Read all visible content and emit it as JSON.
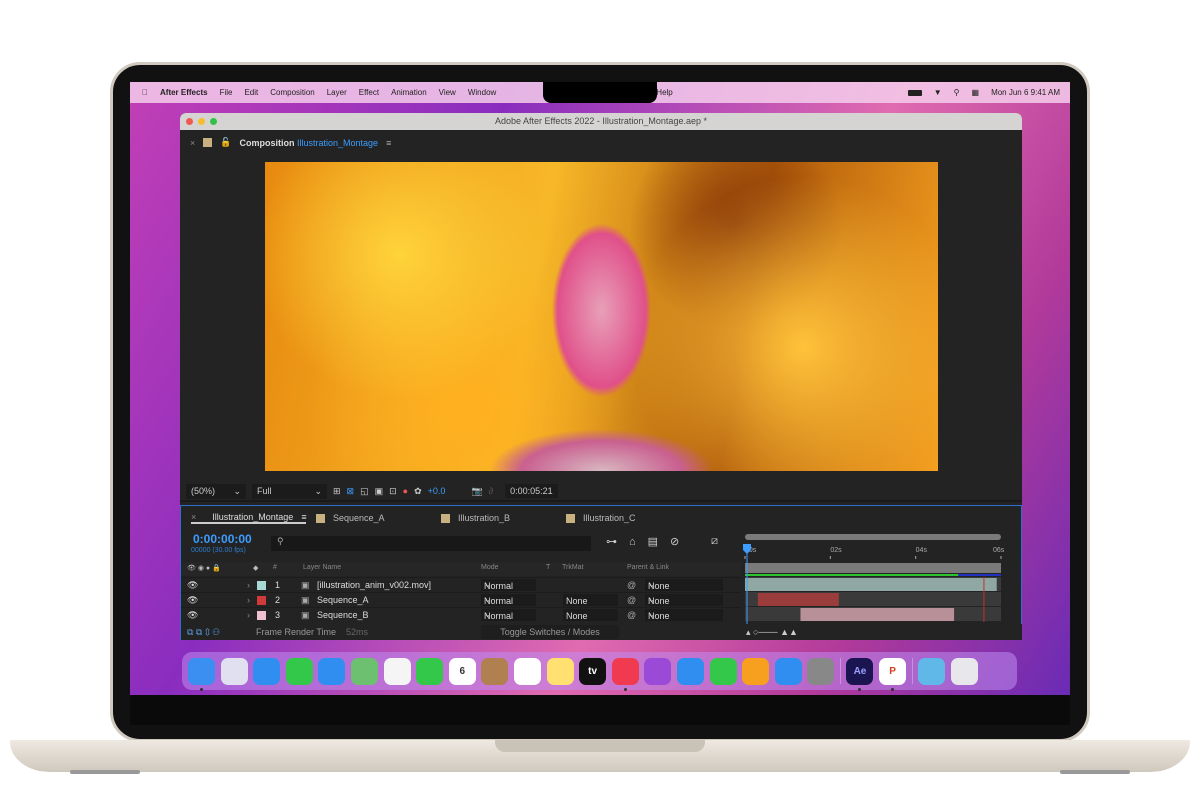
{
  "menubar": {
    "app": "After Effects",
    "items": [
      "File",
      "Edit",
      "Composition",
      "Layer",
      "Effect",
      "Animation",
      "View",
      "Window",
      "Help"
    ],
    "clock": "Mon Jun 6  9:41 AM",
    "icons": [
      "battery-icon",
      "wifi-icon",
      "search-icon",
      "control-center-icon"
    ]
  },
  "window": {
    "title": "Adobe After Effects 2022 - Illustration_Montage.aep *"
  },
  "composition": {
    "label": "Composition",
    "name": "Illustration_Montage"
  },
  "viewer": {
    "zoom": "(50%)",
    "resolution": "Full",
    "exposure": "+0.0",
    "timecode": "0:00:05:21"
  },
  "timeline": {
    "tabs": [
      "Illustration_Montage",
      "Sequence_A",
      "Illustration_B",
      "Illustration_C"
    ],
    "timecode": "0:00:00:00",
    "fps": "00000 (30.00 fps)",
    "search_placeholder": "",
    "headers": {
      "num": "#",
      "layer_name": "Layer Name",
      "mode": "Mode",
      "t": "T",
      "trkmat": "TrkMat",
      "parent": "Parent & Link"
    },
    "layers": [
      {
        "num": "1",
        "name": "[illustration_anim_v002.mov]",
        "mode": "Normal",
        "trkmat": "",
        "parent": "None",
        "color": "#a8d8d4",
        "bar_color": "#8fa8a4",
        "start": 0,
        "end": 5.9
      },
      {
        "num": "2",
        "name": "Sequence_A",
        "mode": "Normal",
        "trkmat": "None",
        "parent": "None",
        "color": "#d03a3a",
        "bar_color": "#9a3c3c",
        "start": 0.3,
        "end": 2.2
      },
      {
        "num": "3",
        "name": "Sequence_B",
        "mode": "Normal",
        "trkmat": "None",
        "parent": "None",
        "color": "#f0c0d0",
        "bar_color": "#b89098",
        "start": 1.3,
        "end": 4.9
      }
    ],
    "ruler": [
      "00s",
      "02s",
      "04s",
      "06s"
    ],
    "footer": {
      "render_label": "Frame Render Time",
      "render_time": "52ms",
      "toggle": "Toggle Switches / Modes"
    }
  },
  "dock": {
    "apps": [
      {
        "name": "Finder",
        "color": "#3a8ff0",
        "running": true
      },
      {
        "name": "Launchpad",
        "color": "#e0e0f0"
      },
      {
        "name": "Safari",
        "color": "#2f8ef0"
      },
      {
        "name": "Messages",
        "color": "#33c84a"
      },
      {
        "name": "Mail",
        "color": "#2f8ef0"
      },
      {
        "name": "Maps",
        "color": "#6cc070"
      },
      {
        "name": "Photos",
        "color": "#f5f5f5"
      },
      {
        "name": "FaceTime",
        "color": "#33c84a"
      },
      {
        "name": "Calendar",
        "color": "#ffffff",
        "label": "6",
        "sub": "JUN"
      },
      {
        "name": "Contacts",
        "color": "#b08050"
      },
      {
        "name": "Reminders",
        "color": "#ffffff"
      },
      {
        "name": "Notes",
        "color": "#ffe070"
      },
      {
        "name": "TV",
        "color": "#111111",
        "label": "tv"
      },
      {
        "name": "Music",
        "color": "#f03a50",
        "running": true
      },
      {
        "name": "Podcasts",
        "color": "#9b4ad8"
      },
      {
        "name": "Keynote",
        "color": "#2f8ef0"
      },
      {
        "name": "Numbers",
        "color": "#33c84a"
      },
      {
        "name": "Pages",
        "color": "#f7a020"
      },
      {
        "name": "App Store",
        "color": "#2f8ef0"
      },
      {
        "name": "System Preferences",
        "color": "#888888"
      },
      {
        "name": "After Effects",
        "color": "#1a1450",
        "label": "Ae",
        "running": true,
        "group": 2
      },
      {
        "name": "PowerPoint",
        "color": "#ffffff",
        "label": "P",
        "running": true
      },
      {
        "name": "Downloads",
        "color": "#60b8e8",
        "group": 3
      },
      {
        "name": "Trash",
        "color": "#e8e8ec"
      }
    ]
  }
}
